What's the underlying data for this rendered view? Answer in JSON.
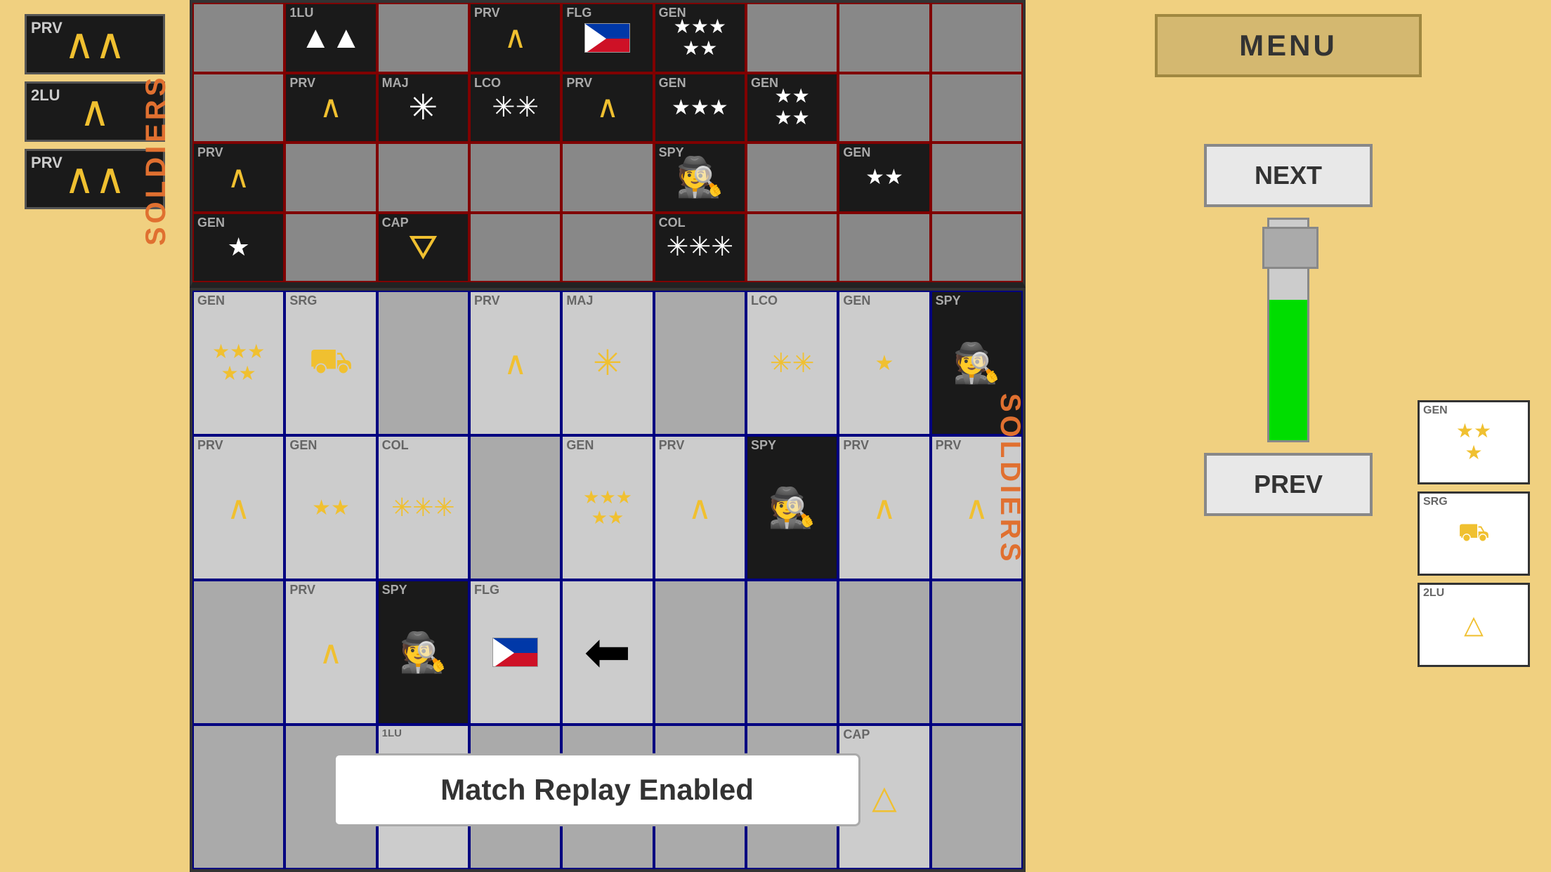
{
  "ui": {
    "menu_button": "MENU",
    "next_button": "NEXT",
    "prev_button": "PREV",
    "notification": "Match Replay Enabled",
    "left_sidebar_label": "SOLDIERS",
    "right_sidebar_label": "SOLDIERS"
  },
  "left_pieces": [
    {
      "rank": "PRV",
      "symbol": "^^"
    },
    {
      "rank": "2LU",
      "symbol": "^"
    },
    {
      "rank": "PRV",
      "symbol": "^^"
    }
  ],
  "top_board": {
    "rows": 4,
    "cols": 9,
    "cells": [
      {
        "row": 0,
        "col": 1,
        "rank": "1LU",
        "symbol": "stars2",
        "bg": "dark",
        "color": "white"
      },
      {
        "row": 0,
        "col": 3,
        "rank": "PRV",
        "symbol": "chevron",
        "bg": "dark",
        "color": "yellow"
      },
      {
        "row": 0,
        "col": 4,
        "rank": "FLG",
        "symbol": "flag",
        "bg": "dark",
        "color": "flag"
      },
      {
        "row": 0,
        "col": 5,
        "rank": "GEN",
        "symbol": "stars5",
        "bg": "dark",
        "color": "white"
      },
      {
        "row": 1,
        "col": 1,
        "rank": "PRV",
        "symbol": "chevron",
        "bg": "dark",
        "color": "yellow"
      },
      {
        "row": 1,
        "col": 2,
        "rank": "MAJ",
        "symbol": "snowflake",
        "bg": "dark",
        "color": "white"
      },
      {
        "row": 1,
        "col": 3,
        "rank": "LCO",
        "symbol": "snowflakes2",
        "bg": "dark",
        "color": "white"
      },
      {
        "row": 1,
        "col": 4,
        "rank": "PRV",
        "symbol": "chevron",
        "bg": "dark",
        "color": "yellow"
      },
      {
        "row": 1,
        "col": 5,
        "rank": "GEN",
        "symbol": "stars3",
        "bg": "dark",
        "color": "white"
      },
      {
        "row": 1,
        "col": 6,
        "rank": "GEN",
        "symbol": "stars4",
        "bg": "dark",
        "color": "white"
      },
      {
        "row": 2,
        "col": 0,
        "rank": "PRV",
        "symbol": "chevron",
        "bg": "dark",
        "color": "yellow"
      },
      {
        "row": 2,
        "col": 5,
        "rank": "SPY",
        "symbol": "spy",
        "bg": "dark",
        "color": "white"
      },
      {
        "row": 2,
        "col": 7,
        "rank": "GEN",
        "symbol": "stars2b",
        "bg": "dark",
        "color": "white"
      },
      {
        "row": 3,
        "col": 0,
        "rank": "GEN",
        "symbol": "star1",
        "bg": "dark",
        "color": "white"
      },
      {
        "row": 3,
        "col": 2,
        "rank": "CAP",
        "symbol": "triforce",
        "bg": "dark",
        "color": "yellow"
      },
      {
        "row": 3,
        "col": 5,
        "rank": "COL",
        "symbol": "snowflakes3",
        "bg": "dark",
        "color": "white"
      }
    ]
  },
  "bottom_board": {
    "rows": 4,
    "cols": 9,
    "cells": [
      {
        "row": 0,
        "col": 0,
        "rank": "GEN",
        "symbol": "stars3b",
        "bg": "light",
        "color": "yellow"
      },
      {
        "row": 0,
        "col": 1,
        "rank": "SRG",
        "symbol": "sergeant",
        "bg": "light",
        "color": "yellow"
      },
      {
        "row": 0,
        "col": 3,
        "rank": "PRV",
        "symbol": "chevron",
        "bg": "light",
        "color": "yellow"
      },
      {
        "row": 0,
        "col": 4,
        "rank": "MAJ",
        "symbol": "snowflake",
        "bg": "light",
        "color": "yellow"
      },
      {
        "row": 0,
        "col": 6,
        "rank": "LCO",
        "symbol": "snowflakes2",
        "bg": "light",
        "color": "yellow"
      },
      {
        "row": 0,
        "col": 7,
        "rank": "GEN",
        "symbol": "star1",
        "bg": "light",
        "color": "yellow"
      },
      {
        "row": 0,
        "col": 8,
        "rank": "SPY",
        "symbol": "spy",
        "bg": "light",
        "color": "black"
      },
      {
        "row": 1,
        "col": 0,
        "rank": "PRV",
        "symbol": "chevron",
        "bg": "light",
        "color": "yellow"
      },
      {
        "row": 1,
        "col": 1,
        "rank": "GEN",
        "symbol": "stars2",
        "bg": "light",
        "color": "yellow"
      },
      {
        "row": 1,
        "col": 2,
        "rank": "COL",
        "symbol": "snowflakes3",
        "bg": "light",
        "color": "yellow"
      },
      {
        "row": 1,
        "col": 4,
        "rank": "GEN",
        "symbol": "stars5b",
        "bg": "light",
        "color": "yellow"
      },
      {
        "row": 1,
        "col": 5,
        "rank": "PRV",
        "symbol": "chevron",
        "bg": "light",
        "color": "yellow"
      },
      {
        "row": 1,
        "col": 6,
        "rank": "SPY",
        "symbol": "spy",
        "bg": "light",
        "color": "black"
      },
      {
        "row": 1,
        "col": 7,
        "rank": "PRV",
        "symbol": "chevron",
        "bg": "light",
        "color": "yellow"
      },
      {
        "row": 1,
        "col": 8,
        "rank": "PRV",
        "symbol": "chevron",
        "bg": "light",
        "color": "yellow"
      },
      {
        "row": 2,
        "col": 1,
        "rank": "PRV",
        "symbol": "chevron",
        "bg": "light",
        "color": "yellow"
      },
      {
        "row": 2,
        "col": 2,
        "rank": "SPY",
        "symbol": "spy",
        "bg": "light",
        "color": "black"
      },
      {
        "row": 2,
        "col": 3,
        "rank": "FLG",
        "symbol": "flag",
        "bg": "light",
        "color": "flag"
      },
      {
        "row": 2,
        "col": 4,
        "rank": "ARR",
        "symbol": "arrow_left",
        "bg": "light",
        "color": "black"
      },
      {
        "row": 3,
        "col": 2,
        "rank": "1LU",
        "symbol": "triangle",
        "bg": "light",
        "color": "yellow"
      },
      {
        "row": 3,
        "col": 7,
        "rank": "CAP",
        "symbol": "triangle",
        "bg": "light",
        "color": "yellow"
      }
    ]
  },
  "right_small_pieces": [
    {
      "rank": "GEN",
      "symbol": "stars2",
      "bg": "light"
    },
    {
      "rank": "SRG",
      "symbol": "sergeant",
      "bg": "light"
    },
    {
      "rank": "2LU",
      "symbol": "triangle",
      "bg": "light"
    }
  ]
}
